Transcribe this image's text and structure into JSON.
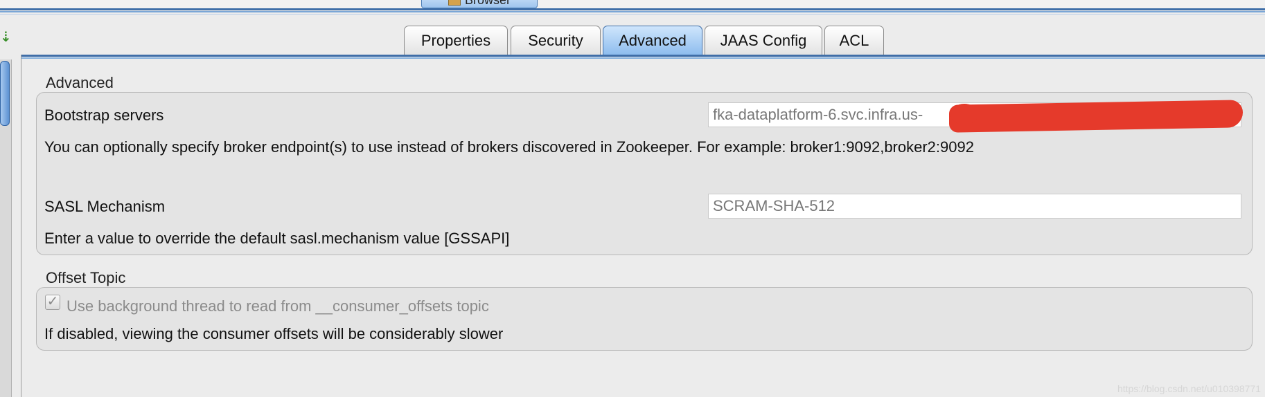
{
  "top_tab": {
    "label": "Browser"
  },
  "tabs": [
    "Properties",
    "Security",
    "Advanced",
    "JAAS Config",
    "ACL"
  ],
  "active_tab": "Advanced",
  "advanced_group": {
    "title": "Advanced",
    "bootstrap": {
      "label": "Bootstrap servers",
      "value": "fka-dataplatform-6.svc.infra.us-",
      "help": "You can optionally specify broker endpoint(s) to use instead of brokers discovered in Zookeeper. For example: broker1:9092,broker2:9092"
    },
    "sasl": {
      "label": "SASL Mechanism",
      "value": "SCRAM-SHA-512",
      "help": "Enter a value to override the default sasl.mechanism value [GSSAPI]"
    }
  },
  "offset_group": {
    "title": "Offset Topic",
    "checkbox_label": "Use background thread to read from __consumer_offsets topic",
    "checkbox_checked": true,
    "help": "If disabled, viewing the consumer offsets will be considerably slower"
  },
  "watermark": "https://blog.csdn.net/u010398771"
}
